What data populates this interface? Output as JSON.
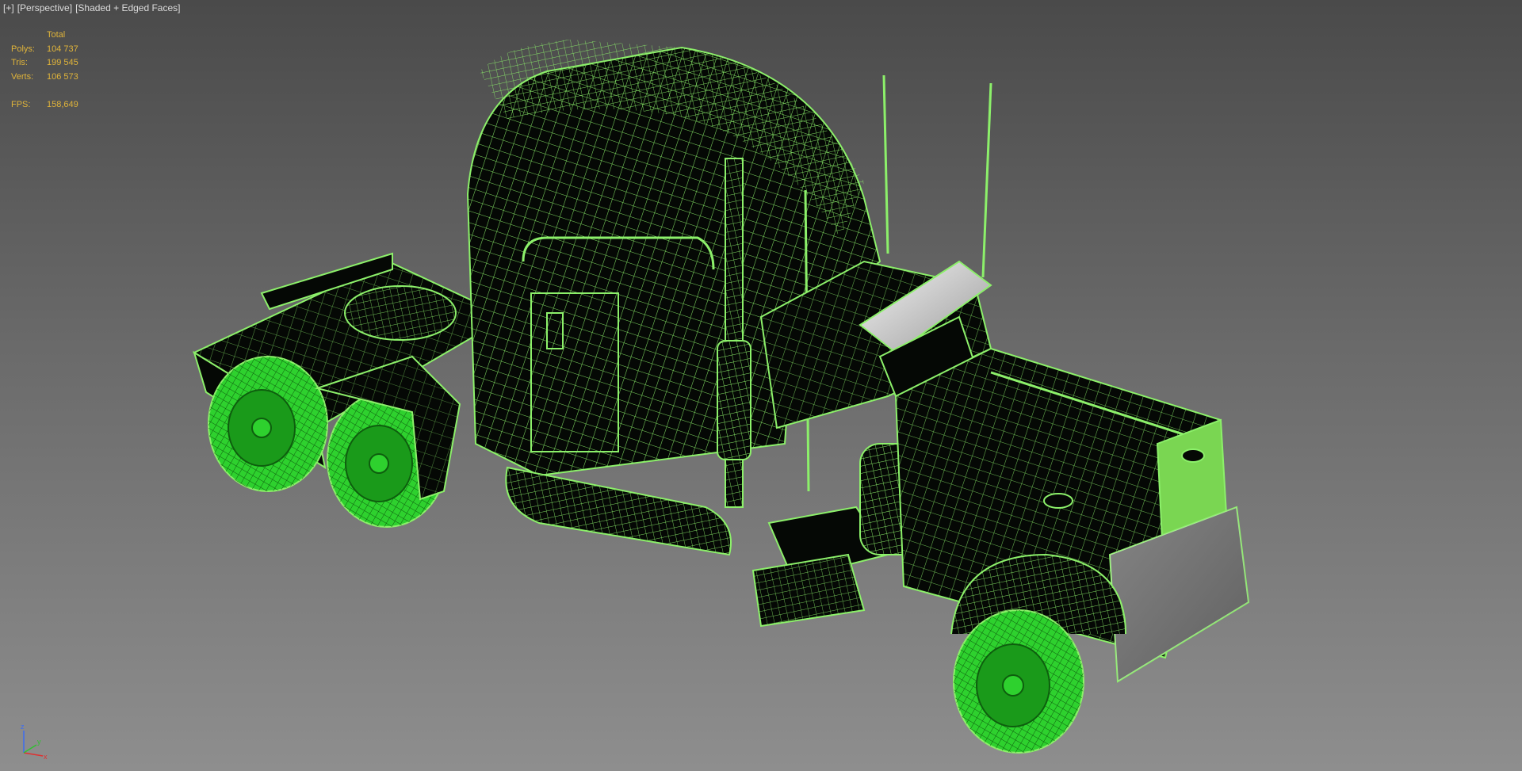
{
  "viewport": {
    "menu_plus": "[+]",
    "menu_view": "[Perspective]",
    "menu_shading": "[Shaded + Edged Faces]",
    "background_top": "#4a4a4a",
    "background_bottom": "#8e8e8e"
  },
  "stats": {
    "header": "Total",
    "polys_label": "Polys:",
    "polys_value": "104 737",
    "tris_label": "Tris:",
    "tris_value": "199 545",
    "verts_label": "Verts:",
    "verts_value": "106 573",
    "fps_label": "FPS:",
    "fps_value": "158,649",
    "text_color": "#e0b43a"
  },
  "model": {
    "wire_color": "#8cf06a",
    "shell_color": "#050805",
    "tire_color": "#2ed12e"
  },
  "gizmo": {
    "z_label": "z",
    "x_label": "x",
    "y_label": "y"
  }
}
